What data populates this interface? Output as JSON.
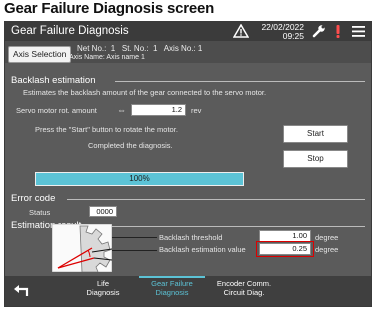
{
  "caption": "Gear Failure Diagnosis screen",
  "window": {
    "title": "Gear Failure Diagnosis",
    "date": "22/02/2022",
    "time": "09:25",
    "icons": [
      "warning-icon",
      "wrench-icon",
      "alarm-icon",
      "menu-icon"
    ]
  },
  "info": {
    "axis_selection_label": "Axis Selection",
    "net_no": "Net No.:  1   St. No.:  1   Axis No.: 1",
    "axis_name": "Axis Name: Axis name 1"
  },
  "backlash": {
    "heading": "Backlash estimation",
    "description": "Estimates the backlash amount of the gear connected to the servo motor.",
    "servo_label": "Servo motor rot. amount",
    "servo_arrows": "⇔",
    "servo_value": "1.2",
    "servo_unit": "rev",
    "instruction": "Press the \"Start\" button to rotate the motor.",
    "status_text": "Completed the diagnosis.",
    "progress_text": "100%",
    "progress_fraction": 1.0,
    "start_label": "Start",
    "stop_label": "Stop"
  },
  "error": {
    "heading": "Error code",
    "status_label": "Status",
    "status_value": "0000"
  },
  "result": {
    "heading": "Estimation result",
    "threshold_label": "Backlash threshold",
    "threshold_value": "1.00",
    "threshold_unit": "degree",
    "estimation_label": "Backlash estimation value",
    "estimation_value": "0.25",
    "estimation_unit": "degree"
  },
  "tabs": [
    {
      "line1": "Life",
      "line2": "Diagnosis"
    },
    {
      "line1": "Gear Failure",
      "line2": "Diagnosis"
    },
    {
      "line1": "Encoder Comm.",
      "line2": "Circuit Diag."
    }
  ],
  "colors": {
    "accent": "#5cc3d6",
    "highlight": "#dd0000",
    "background": "#5b5b5b"
  }
}
